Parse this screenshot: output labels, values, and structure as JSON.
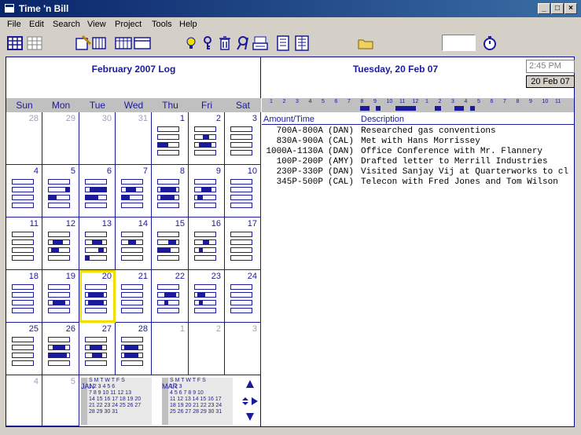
{
  "window": {
    "title": "Time 'n Bill"
  },
  "menu": [
    "File",
    "Edit",
    "Search",
    "View",
    "Project",
    "Tools",
    "Help"
  ],
  "left": {
    "title": "February 2007 Log",
    "weekdays": [
      "Sun",
      "Mon",
      "Tue",
      "Wed",
      "Thu",
      "Fri",
      "Sat"
    ],
    "days": [
      "28",
      "29",
      "30",
      "31",
      "1",
      "2",
      "3",
      "4",
      "5",
      "6",
      "7",
      "8",
      "9",
      "10",
      "11",
      "12",
      "13",
      "14",
      "15",
      "16",
      "17",
      "18",
      "19",
      "20",
      "21",
      "22",
      "23",
      "24",
      "25",
      "26",
      "27",
      "28",
      "1",
      "2",
      "3",
      "4",
      "5"
    ],
    "today_index": 23,
    "mini_jan": {
      "label": "JAN",
      "header": "S M T W T F S",
      "rows": [
        "1 2 3 4 5 6",
        "7 8 9 10 11 12 13",
        "14 15 16 17 18 19 20",
        "21 22 23 24 25 26 27",
        "28 29 30 31"
      ]
    },
    "mini_mar": {
      "label": "MAR",
      "header": "S M T W T F S",
      "rows": [
        "1 2 3",
        "4 5 6 7 8 9 10",
        "11 12 13 14 15 16 17",
        "18 19 20 21 22 23 24",
        "25 26 27 28 29 30 31"
      ]
    }
  },
  "right": {
    "title": "Tuesday, 20 Feb 07",
    "time": "2:45 PM",
    "date_button": "20 Feb 07",
    "ruler": [
      "1",
      "2",
      "3",
      "4",
      "5",
      "6",
      "7",
      "8",
      "9",
      "10",
      "11",
      "12",
      "1",
      "2",
      "3",
      "4",
      "5",
      "6",
      "7",
      "8",
      "9",
      "10",
      "11"
    ],
    "col_amount": "Amount/Time",
    "col_desc": "Description",
    "entries": [
      {
        "time": " 700A-800A",
        "who": "(DAN)",
        "desc": "Researched gas conventions"
      },
      {
        "time": " 830A-900A",
        "who": "(CAL)",
        "desc": "Met with Hans Morrissey"
      },
      {
        "time": "1000A-1130A",
        "who": "(DAN)",
        "desc": "Office Conference with Mr. Flannery"
      },
      {
        "time": " 100P-200P",
        "who": "(AMY)",
        "desc": "Drafted letter to Merrill Industries"
      },
      {
        "time": " 230P-330P",
        "who": "(DAN)",
        "desc": "Visited Sanjay Vij at Quarterworks to cl"
      },
      {
        "time": " 345P-500P",
        "who": "(CAL)",
        "desc": "Telecon with Fred Jones and Tom Wilson"
      }
    ]
  },
  "colors": {
    "accent": "#1a1a9a",
    "today": "#f0e000"
  }
}
